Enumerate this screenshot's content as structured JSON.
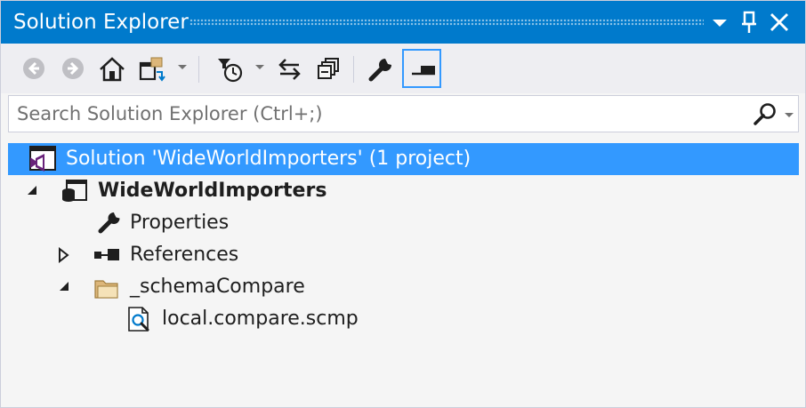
{
  "window": {
    "title": "Solution Explorer"
  },
  "titlebar_buttons": [
    {
      "name": "window-position-dropdown",
      "icon": "chevron-down-icon"
    },
    {
      "name": "pin",
      "icon": "pin-icon"
    },
    {
      "name": "close",
      "icon": "close-icon"
    }
  ],
  "toolbar": {
    "tools": [
      {
        "name": "back",
        "icon": "back-icon",
        "enabled": false
      },
      {
        "name": "forward",
        "icon": "forward-icon",
        "enabled": false
      },
      {
        "name": "home",
        "icon": "home-icon",
        "enabled": true
      },
      {
        "name": "switch-views",
        "icon": "switch-views-icon",
        "enabled": true
      },
      {
        "name": "pending-changes-filter",
        "icon": "clock-filter-icon",
        "enabled": true
      },
      {
        "name": "sync-with-active-document",
        "icon": "sync-icon",
        "enabled": true
      },
      {
        "name": "collapse-all",
        "icon": "collapse-all-icon",
        "enabled": true
      },
      {
        "name": "properties",
        "icon": "wrench-icon",
        "enabled": true
      },
      {
        "name": "preview-selected-items",
        "icon": "preview-icon",
        "enabled": true,
        "active": true
      }
    ]
  },
  "search": {
    "placeholder": "Search Solution Explorer (Ctrl+;)",
    "value": ""
  },
  "tree": {
    "items": [
      {
        "label": "Solution 'WideWorldImporters' (1 project)",
        "icon": "solution-icon",
        "selected": true,
        "level": 0
      },
      {
        "label": "WideWorldImporters",
        "icon": "database-project-icon",
        "expanded": true,
        "bold": true,
        "level": 0
      },
      {
        "label": "Properties",
        "icon": "wrench-icon",
        "level": 1
      },
      {
        "label": "References",
        "icon": "references-icon",
        "expanded": false,
        "level": 1
      },
      {
        "label": "_schemaCompare",
        "icon": "folder-icon",
        "expanded": true,
        "level": 1
      },
      {
        "label": "local.compare.scmp",
        "icon": "schema-compare-file-icon",
        "level": 2
      }
    ]
  },
  "colors": {
    "accent": "#007acc",
    "selection": "#3399ff",
    "background": "#f5f5f5",
    "toolbar": "#eeeef2",
    "folder": "#dcb67a"
  }
}
